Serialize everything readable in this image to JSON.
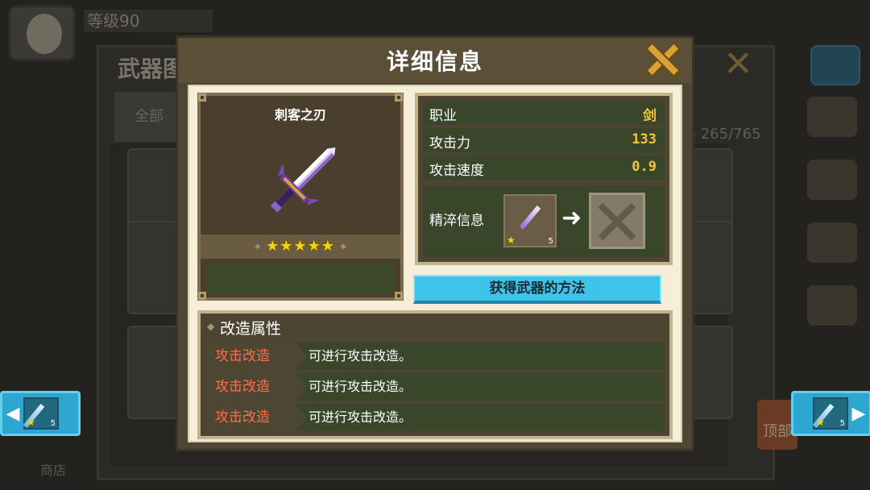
{
  "background": {
    "player_name": "等级90",
    "window_title": "武器图",
    "tab_all": "全部",
    "count": "器 265/765",
    "top_button": "顶部",
    "shop": "商店"
  },
  "modal": {
    "title": "详细信息",
    "weapon": {
      "name": "刺客之刃",
      "stars": "★★★★★",
      "star_count": 5
    },
    "stats": [
      {
        "label": "职业",
        "value": "剑"
      },
      {
        "label": "攻击力",
        "value": "133"
      },
      {
        "label": "攻击速度",
        "value": "0.9"
      }
    ],
    "refine": {
      "label": "精淬信息",
      "source_level": "5"
    },
    "obtain_button": "获得武器的方法",
    "modify": {
      "title": "改造属性",
      "rows": [
        {
          "tag": "攻击改造",
          "desc": "可进行攻击改造。"
        },
        {
          "tag": "攻击改造",
          "desc": "可进行攻击改造。"
        },
        {
          "tag": "攻击改造",
          "desc": "可进行攻击改造。"
        }
      ]
    }
  },
  "nav": {
    "left_level": "5",
    "right_level": "5"
  }
}
